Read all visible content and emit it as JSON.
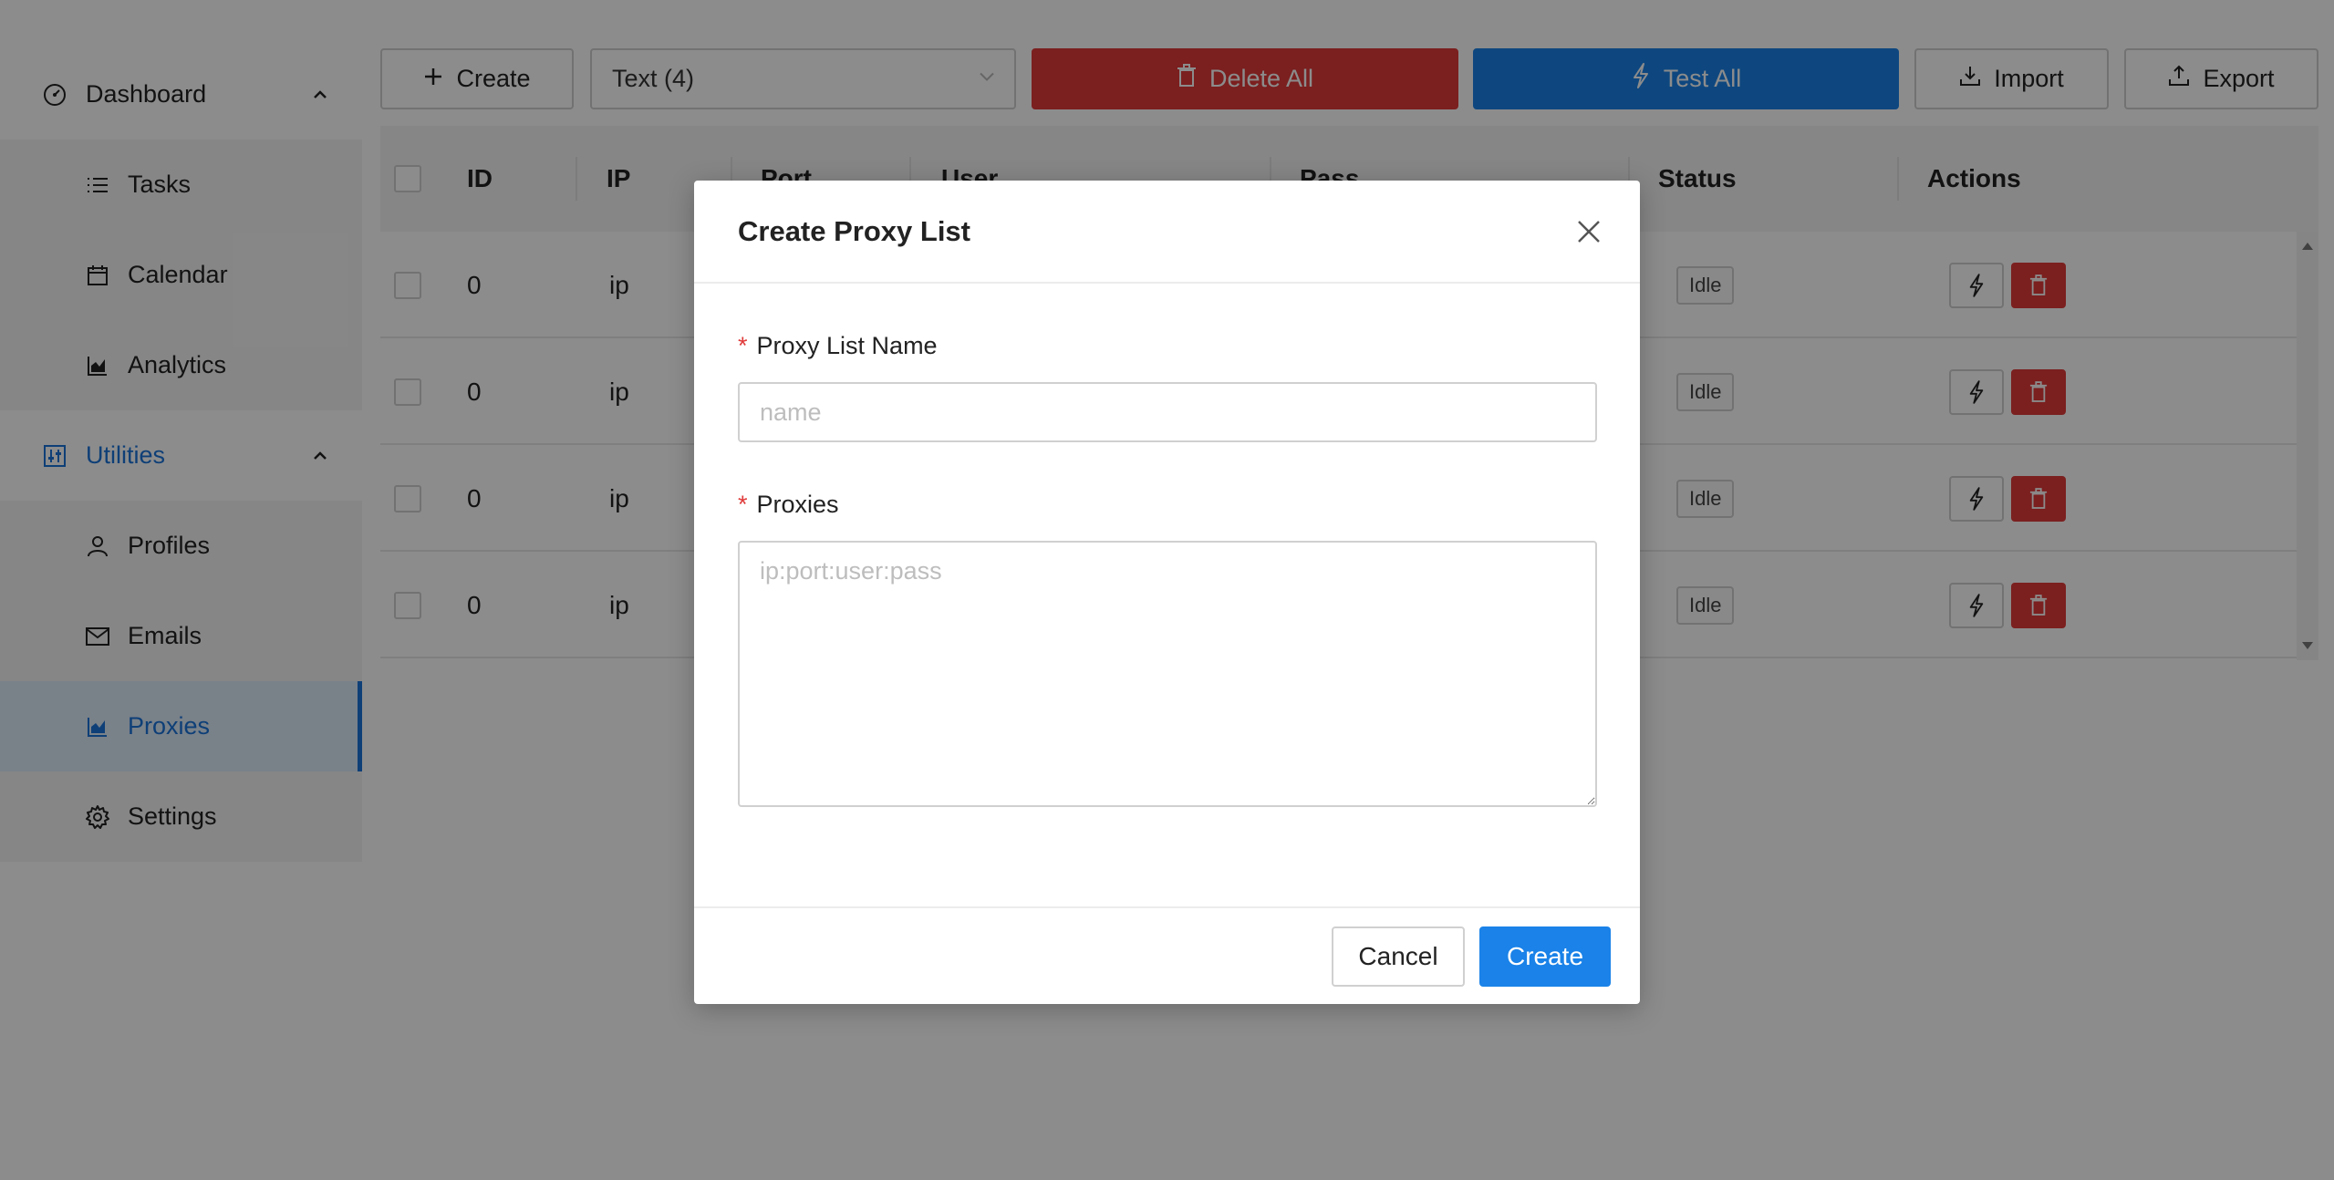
{
  "sidebar": {
    "groups": [
      {
        "label": "Dashboard",
        "icon": "dashboard-gauge-icon",
        "expanded": true,
        "items": [
          {
            "label": "Tasks",
            "icon": "list-icon"
          },
          {
            "label": "Calendar",
            "icon": "calendar-icon"
          },
          {
            "label": "Analytics",
            "icon": "area-chart-icon"
          }
        ]
      },
      {
        "label": "Utilities",
        "icon": "sliders-icon",
        "expanded": true,
        "active": true,
        "items": [
          {
            "label": "Profiles",
            "icon": "user-icon"
          },
          {
            "label": "Emails",
            "icon": "mail-icon"
          },
          {
            "label": "Proxies",
            "icon": "area-chart-icon",
            "selected": true
          },
          {
            "label": "Settings",
            "icon": "gear-icon"
          }
        ]
      }
    ]
  },
  "toolbar": {
    "create_label": "Create",
    "select_value": "Text (4)",
    "delete_all_label": "Delete All",
    "test_all_label": "Test All",
    "import_label": "Import",
    "export_label": "Export"
  },
  "table": {
    "headers": [
      "ID",
      "IP",
      "Port",
      "User",
      "Pass",
      "Status",
      "Actions"
    ],
    "rows": [
      {
        "id": "0",
        "ip": "ip",
        "status": "Idle"
      },
      {
        "id": "0",
        "ip": "ip",
        "status": "Idle"
      },
      {
        "id": "0",
        "ip": "ip",
        "status": "Idle"
      },
      {
        "id": "0",
        "ip": "ip",
        "status": "Idle"
      }
    ]
  },
  "modal": {
    "title": "Create Proxy List",
    "name_label": "Proxy List Name",
    "name_placeholder": "name",
    "proxies_label": "Proxies",
    "proxies_placeholder": "ip:port:user:pass",
    "required_mark": "*",
    "cancel_label": "Cancel",
    "create_label": "Create"
  },
  "colors": {
    "accent": "#1a82e8",
    "danger": "#e03a3a",
    "active_nav": "#1a73d9"
  }
}
